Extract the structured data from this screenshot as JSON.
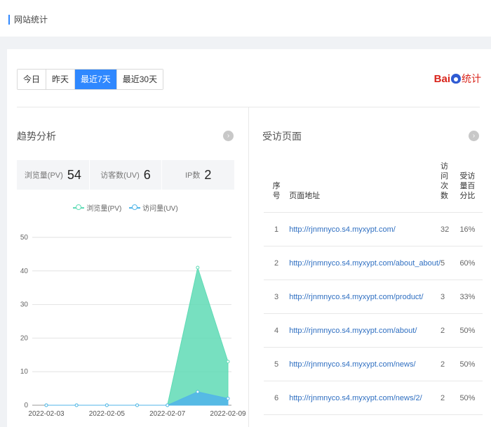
{
  "header": {
    "breadcrumb": "网站统计"
  },
  "range_tabs": [
    {
      "label": "今日",
      "active": false
    },
    {
      "label": "昨天",
      "active": false
    },
    {
      "label": "最近7天",
      "active": true
    },
    {
      "label": "最近30天",
      "active": false
    }
  ],
  "logo": {
    "text_a": "Bai",
    "text_b": "统计",
    "icon": "baidu-paw-icon"
  },
  "trend": {
    "title": "趋势分析",
    "more_icon": "chevron-right-circle-icon",
    "stats": [
      {
        "label": "浏览量(PV)",
        "value": "54"
      },
      {
        "label": "访客数(UV)",
        "value": "6"
      },
      {
        "label": "IP数",
        "value": "2"
      }
    ]
  },
  "pages": {
    "title": "受访页面",
    "more_icon": "chevron-right-circle-icon",
    "columns": [
      "序号",
      "页面地址",
      "访问次数",
      "受访量百分比"
    ],
    "rows": [
      {
        "no": "1",
        "url": "http://rjnmnyco.s4.myxypt.com/",
        "visits": "32",
        "pct": "16%"
      },
      {
        "no": "2",
        "url": "http://rjnmnyco.s4.myxypt.com/about_about/",
        "visits": "5",
        "pct": "60%"
      },
      {
        "no": "3",
        "url": "http://rjnmnyco.s4.myxypt.com/product/",
        "visits": "3",
        "pct": "33%"
      },
      {
        "no": "4",
        "url": "http://rjnmnyco.s4.myxypt.com/about/",
        "visits": "2",
        "pct": "50%"
      },
      {
        "no": "5",
        "url": "http://rjnmnyco.s4.myxypt.com/news/",
        "visits": "2",
        "pct": "50%"
      },
      {
        "no": "6",
        "url": "http://rjnmnyco.s4.myxypt.com/news/2/",
        "visits": "2",
        "pct": "50%"
      }
    ]
  },
  "colors": {
    "accent": "#2f88ff",
    "pv": "#5fdbb5",
    "uv": "#52b6e8"
  },
  "chart_data": {
    "type": "area",
    "x": [
      "2022-02-03",
      "2022-02-04",
      "2022-02-05",
      "2022-02-06",
      "2022-02-07",
      "2022-02-08",
      "2022-02-09"
    ],
    "x_tick_labels": [
      "2022-02-03",
      "2022-02-05",
      "2022-02-07",
      "2022-02-09"
    ],
    "series": [
      {
        "name": "浏览量(PV)",
        "values": [
          0,
          0,
          0,
          0,
          0,
          41,
          13
        ]
      },
      {
        "name": "访问量(UV)",
        "values": [
          0,
          0,
          0,
          0,
          0,
          4,
          2
        ]
      }
    ],
    "yticks": [
      0,
      10,
      20,
      30,
      40,
      50
    ],
    "ylim": [
      0,
      50
    ],
    "grid": true,
    "legend": "top-center"
  }
}
